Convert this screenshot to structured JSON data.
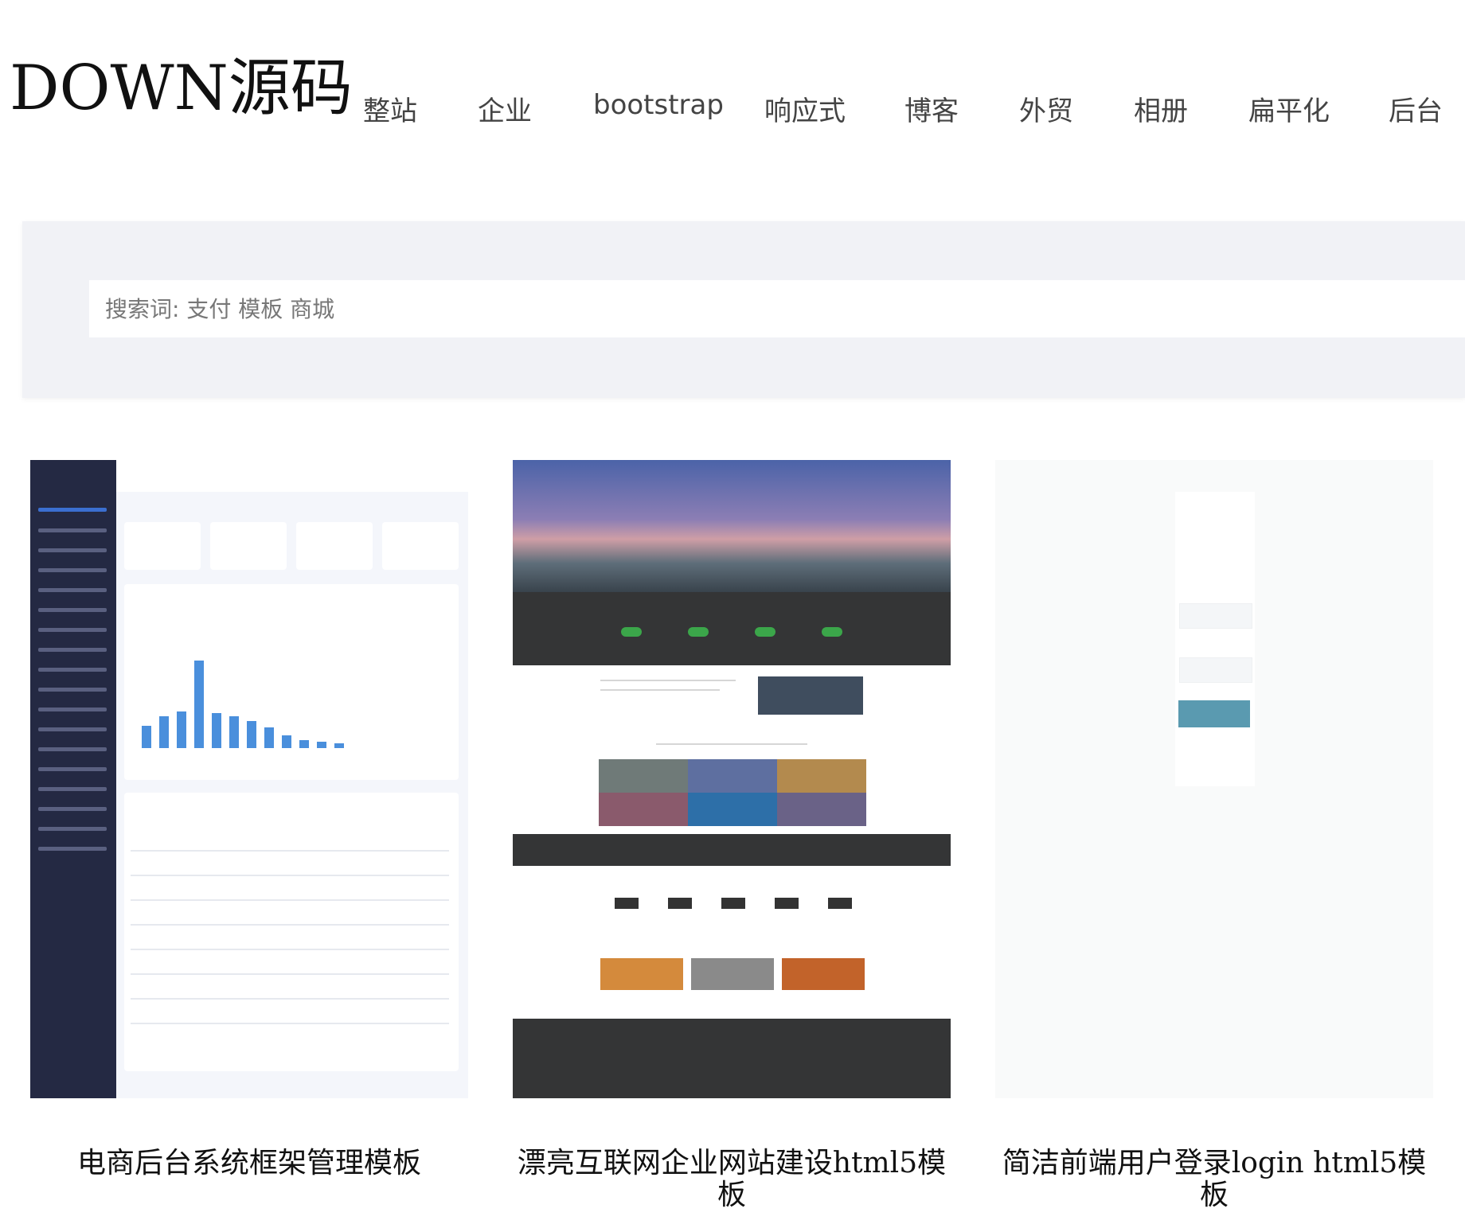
{
  "site": {
    "logo": "DOWN源码"
  },
  "nav": {
    "items": [
      {
        "label": "整站"
      },
      {
        "label": "企业"
      },
      {
        "label": "bootstrap"
      },
      {
        "label": "响应式"
      },
      {
        "label": "博客"
      },
      {
        "label": "外贸"
      },
      {
        "label": "相册"
      },
      {
        "label": "扁平化"
      },
      {
        "label": "后台"
      }
    ]
  },
  "search": {
    "placeholder": "搜索词: 支付 模板 商城"
  },
  "cards": [
    {
      "title": "电商后台系统框架管理模板",
      "preview": "admin-dashboard-screenshot"
    },
    {
      "title": "漂亮互联网企业网站建设html5模板",
      "preview": "corporate-website-screenshot"
    },
    {
      "title": "简洁前端用户登录login html5模板",
      "preview": "login-page-screenshot"
    }
  ]
}
